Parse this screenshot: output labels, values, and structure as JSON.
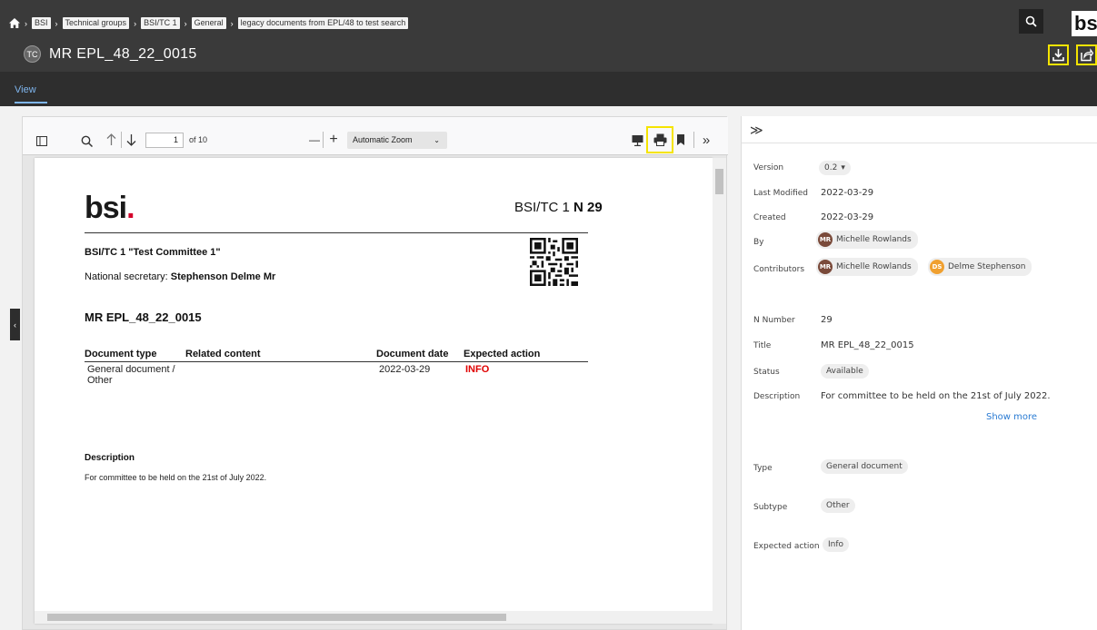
{
  "breadcrumb": [
    "BSI",
    "Technical groups",
    "BSI/TC 1",
    "General",
    "legacy documents from EPL/48 to test search"
  ],
  "header": {
    "badge": "TC",
    "title": "MR EPL_48_22_0015",
    "brand": "bs"
  },
  "tabs": {
    "view": "View"
  },
  "toolbar": {
    "page_number": "1",
    "page_of": "of 10",
    "zoom": "Automatic Zoom",
    "zoom_minus": "—",
    "zoom_plus": "+",
    "sidebar_toggle": "▯",
    "more": "»"
  },
  "document": {
    "logo": "bsi",
    "logo_dot": ".",
    "ref_prefix": "BSI/TC 1 ",
    "ref_num": "N 29",
    "committee": "BSI/TC 1 \"Test Committee 1\"",
    "secretary_label": "National secretary: ",
    "secretary_name": "Stephenson Delme Mr",
    "title": "MR EPL_48_22_0015",
    "table_headers": [
      "Document type",
      "Related content",
      "Document date",
      "Expected action"
    ],
    "row": {
      "type": "General document / Other",
      "date": "2022-03-29",
      "action": "INFO"
    },
    "desc_heading": "Description",
    "desc_text": "For committee to be held on the 21st of July 2022."
  },
  "panel": {
    "collapse": "≫",
    "labels": {
      "version": "Version",
      "last_modified": "Last Modified",
      "created": "Created",
      "by": "By",
      "contributors": "Contributors",
      "n_number": "N Number",
      "title": "Title",
      "status": "Status",
      "description": "Description",
      "type": "Type",
      "subtype": "Subtype",
      "expected_action": "Expected action"
    },
    "values": {
      "version": "0.2",
      "last_modified": "2022-03-29",
      "created": "2022-03-29",
      "by_initials": "MR",
      "by_name": "Michelle Rowlands",
      "contrib1_initials": "MR",
      "contrib1_name": "Michelle Rowlands",
      "contrib2_initials": "DS",
      "contrib2_name": "Delme Stephenson",
      "n_number": "29",
      "title": "MR EPL_48_22_0015",
      "status": "Available",
      "description": "For committee to be held on the 21st of July 2022.",
      "show_more": "Show more",
      "type": "General document",
      "subtype": "Other",
      "expected_action": "Info"
    }
  },
  "colors": {
    "accent": "#7fb6ef",
    "highlight": "#f5e400",
    "info_red": "#e00000",
    "mr_avatar": "#7a4a3a",
    "ds_avatar": "#f0a030"
  }
}
